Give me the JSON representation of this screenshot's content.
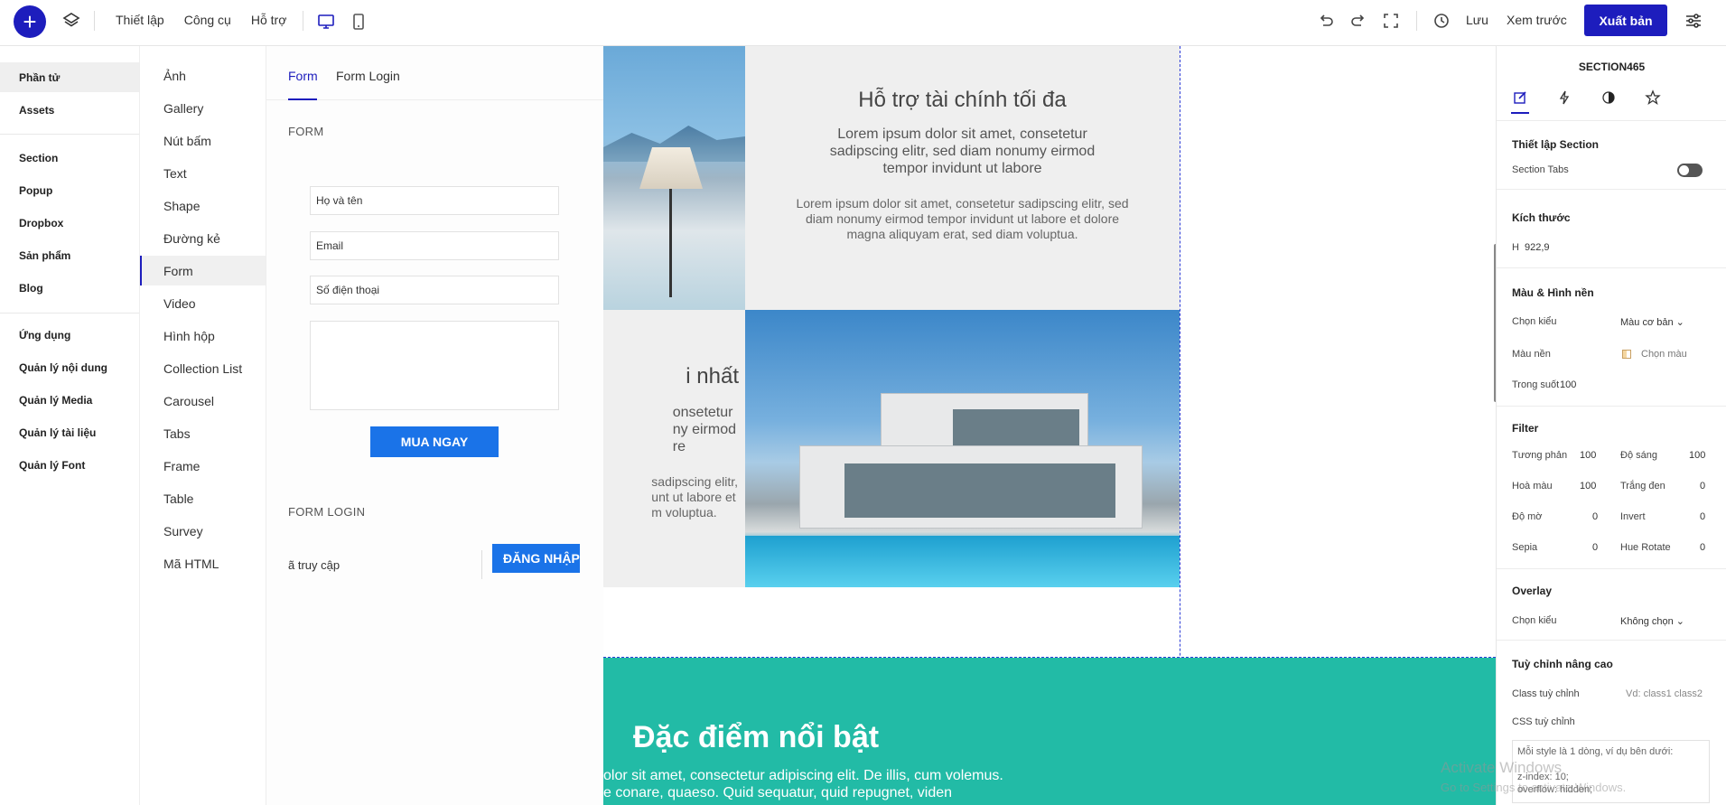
{
  "topbar": {
    "menu": [
      "Thiết lập",
      "Công cụ",
      "Hỗ trợ"
    ],
    "save": "Lưu",
    "preview": "Xem trước",
    "publish": "Xuất bản"
  },
  "panel1": {
    "group1": [
      "Phần tử",
      "Assets"
    ],
    "group2": [
      "Section",
      "Popup",
      "Dropbox",
      "Sản phẩm",
      "Blog"
    ],
    "group3": [
      "Ứng dụng",
      "Quản lý nội dung",
      "Quản lý Media",
      "Quản lý tài liệu",
      "Quản lý Font"
    ]
  },
  "panel2": {
    "items": [
      "Ảnh",
      "Gallery",
      "Nút bấm",
      "Text",
      "Shape",
      "Đường kẻ",
      "Form",
      "Video",
      "Hình hộp",
      "Collection List",
      "Carousel",
      "Tabs",
      "Frame",
      "Table",
      "Survey",
      "Mã HTML"
    ]
  },
  "panel3": {
    "tabs": [
      "Form",
      "Form Login"
    ],
    "form_heading": "FORM",
    "fields": [
      "Họ và tên",
      "Email",
      "Số điện thoại"
    ],
    "buy_button": "MUA NGAY",
    "login_heading": "FORM LOGIN",
    "login_field": "ã truy cập",
    "login_button": "ĐĂNG NHẬP"
  },
  "canvas": {
    "section_title": "Hỗ trợ tài chính tối đa",
    "section_lead": "Lorem ipsum dolor sit amet, consetetur sadipscing elitr, sed diam nonumy eirmod tempor invidunt ut labore",
    "section_small": "Lorem ipsum dolor sit amet, consetetur sadipscing elitr, sed diam nonumy eirmod tempor invidunt ut labore et dolore magna aliquyam erat, sed diam voluptua.",
    "mid_title": "i nhất",
    "mid_lead_1": "onsetetur",
    "mid_lead_2": "ny eirmod",
    "mid_lead_3": "re",
    "mid_small_1": "sadipscing elitr,",
    "mid_small_2": "unt ut labore et",
    "mid_small_3": "m voluptua.",
    "teal_title": "Đặc điểm nổi bật",
    "teal_text_1": "olor sit amet, consectetur adipiscing elit. De illis, cum volemus.",
    "teal_text_2": "e conare, quaeso. Quid sequatur, quid repugnet, viden"
  },
  "rpanel": {
    "title": "SECTION465",
    "setup_title": "Thiết lập Section",
    "section_tabs": "Section Tabs",
    "size_title": "Kích thước",
    "h_label": "H",
    "h_value": "922,9",
    "bg_title": "Màu & Hình nền",
    "choose_type": "Chọn kiểu",
    "type_value": "Màu cơ bản",
    "bg_color": "Màu nền",
    "pick_color": "Chọn màu",
    "opacity": "Trong suốt",
    "opacity_value": "100",
    "filter_title": "Filter",
    "filters": [
      {
        "label": "Tương phản",
        "value": "100"
      },
      {
        "label": "Độ sáng",
        "value": "100"
      },
      {
        "label": "Hoà màu",
        "value": "100"
      },
      {
        "label": "Trắng đen",
        "value": "0"
      },
      {
        "label": "Độ mờ",
        "value": "0"
      },
      {
        "label": "Invert",
        "value": "0"
      },
      {
        "label": "Sepia",
        "value": "0"
      },
      {
        "label": "Hue Rotate",
        "value": "0"
      }
    ],
    "overlay_title": "Overlay",
    "overlay_choose": "Chọn kiểu",
    "overlay_value": "Không chọn",
    "advanced_title": "Tuỳ chỉnh nâng cao",
    "class_label": "Class tuỳ chỉnh",
    "class_placeholder": "Vd: class1 class2",
    "css_label": "CSS tuỳ chỉnh",
    "css_hint": "Mỗi style là 1 dòng, ví dụ bên dưới:",
    "css_ex1": "z-index: 10;",
    "css_ex2": "overflow: hidden;"
  },
  "watermark": {
    "line1": "Activate Windows",
    "line2": "Go to Settings to activate Windows."
  },
  "colors": {
    "accent": "#1d1dbd",
    "button_blue": "#1a73e8",
    "teal": "#22bba6"
  }
}
